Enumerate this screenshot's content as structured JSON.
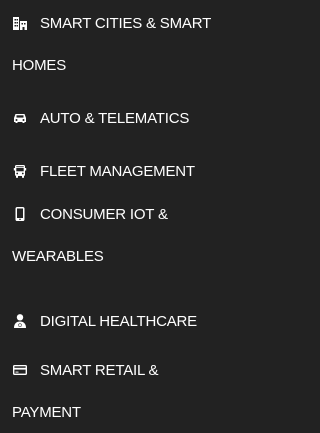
{
  "colors": {
    "background": "#222222",
    "text": "#ffffff",
    "icon": "#ffffff"
  },
  "menu": {
    "items": [
      {
        "icon": "buildings-icon",
        "line1": "SMART CITIES & SMART",
        "line2": "HOMES"
      },
      {
        "icon": "car-icon",
        "line1": "AUTO & TELEMATICS"
      },
      {
        "icon": "bus-icon",
        "line1": "FLEET MANAGEMENT"
      },
      {
        "icon": "mobile-icon",
        "line1": "CONSUMER IOT &",
        "line2": "WEARABLES"
      },
      {
        "icon": "user-md-icon",
        "line1": "DIGITAL HEALTHCARE"
      },
      {
        "icon": "credit-card-icon",
        "line1": "SMART RETAIL &",
        "line2": "PAYMENT"
      }
    ]
  }
}
